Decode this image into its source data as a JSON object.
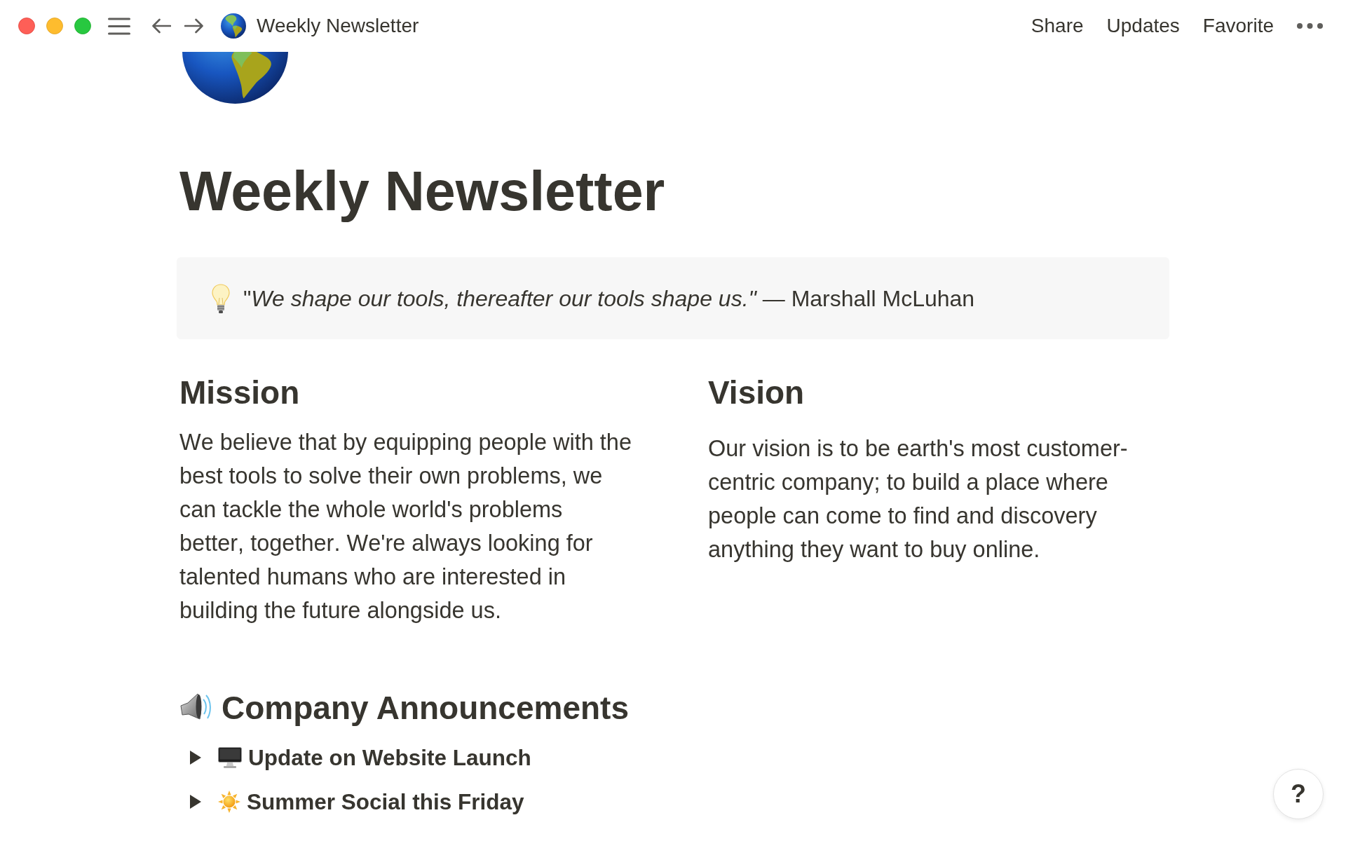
{
  "topbar": {
    "breadcrumb": "Weekly Newsletter",
    "actions": [
      "Share",
      "Updates",
      "Favorite"
    ]
  },
  "page": {
    "title": "Weekly Newsletter",
    "callout": {
      "text": "\"*We shape our tools, thereafter our tools shape us.\"* — Marshall McLuhan"
    },
    "columns": [
      {
        "heading": "Mission",
        "text": "We believe that by equipping people with the best tools to solve their own problems, we can tackle the whole world's problems better, together. We're always looking for talented humans who are interested in building the future alongside us."
      },
      {
        "heading": "Vision",
        "text": "Our vision is to be earth's most customer-centric company; to build a place where people can come to find and discovery anything they want to buy online."
      }
    ],
    "announcements": {
      "heading": "Company Announcements",
      "items": [
        {
          "label": "Update on Website Launch",
          "expanded": false
        },
        {
          "label": "Summer Social this Friday",
          "expanded": false
        }
      ]
    }
  },
  "help_button": {
    "label": "?"
  }
}
